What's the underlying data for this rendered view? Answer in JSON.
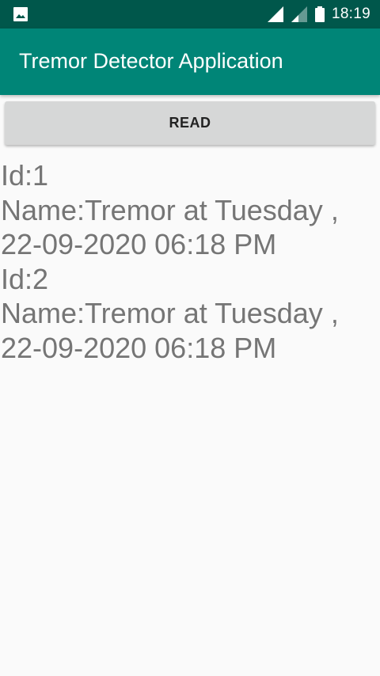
{
  "status_bar": {
    "time": "18:19",
    "icons": [
      "image-notification-icon",
      "signal-icon",
      "signal-weak-icon",
      "battery-icon"
    ]
  },
  "app_bar": {
    "title": "Tremor Detector Application",
    "color": "#008577"
  },
  "read_button": {
    "label": "READ"
  },
  "records": [
    {
      "id_line": "Id:1",
      "name_line_1": "Name:Tremor at Tuesday ,",
      "name_line_2": "22-09-2020 06:18 PM"
    },
    {
      "id_line": "Id:2",
      "name_line_1": "Name:Tremor at Tuesday ,",
      "name_line_2": "22-09-2020 06:18 PM"
    }
  ]
}
